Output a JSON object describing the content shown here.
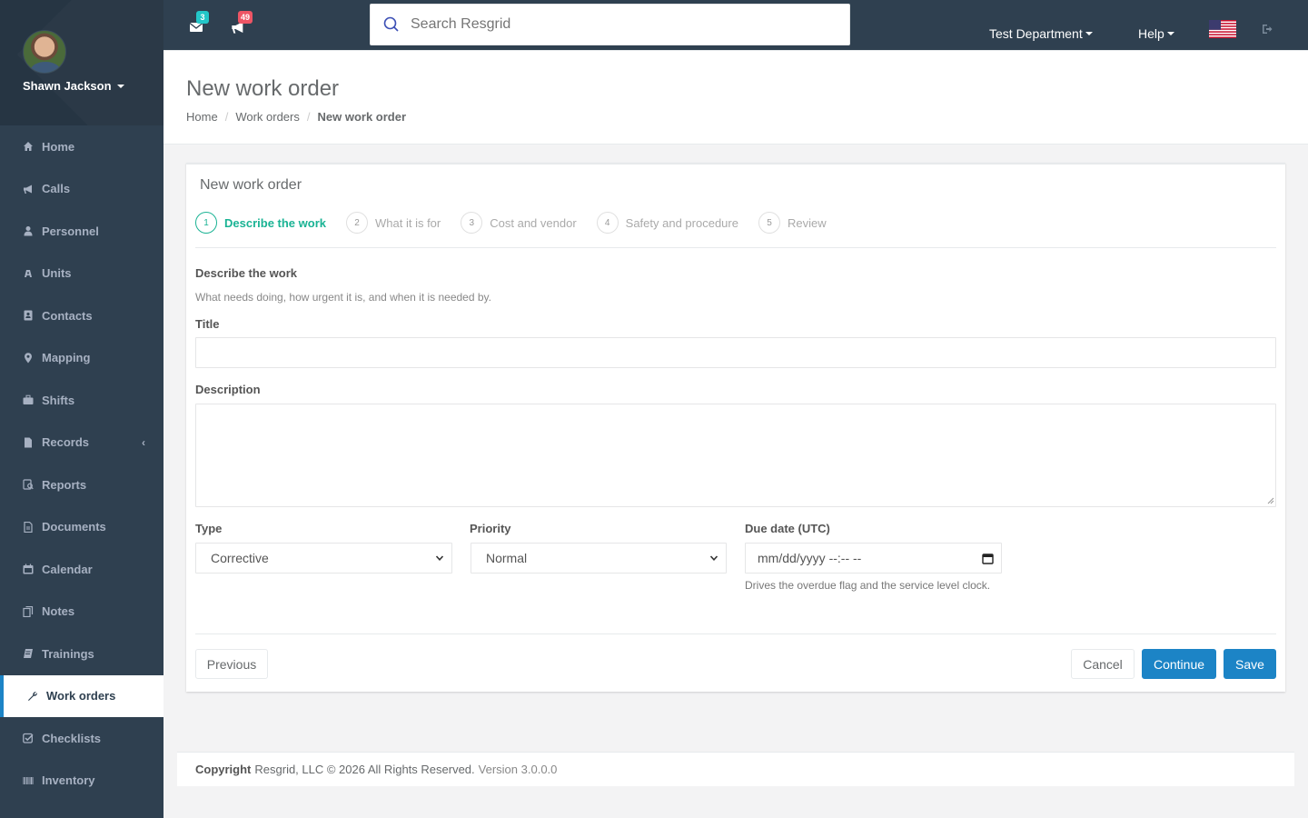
{
  "user": {
    "name": "Shawn Jackson"
  },
  "sidebar": {
    "items": [
      {
        "label": "Home",
        "icon": "home-icon"
      },
      {
        "label": "Calls",
        "icon": "bullhorn-icon"
      },
      {
        "label": "Personnel",
        "icon": "user-icon"
      },
      {
        "label": "Units",
        "icon": "truck-icon"
      },
      {
        "label": "Contacts",
        "icon": "contact-card-icon"
      },
      {
        "label": "Mapping",
        "icon": "map-marker-icon"
      },
      {
        "label": "Shifts",
        "icon": "briefcase-icon"
      },
      {
        "label": "Records",
        "icon": "file-icon",
        "has_submenu": true
      },
      {
        "label": "Reports",
        "icon": "report-icon"
      },
      {
        "label": "Documents",
        "icon": "document-icon"
      },
      {
        "label": "Calendar",
        "icon": "calendar-icon"
      },
      {
        "label": "Notes",
        "icon": "notes-icon"
      },
      {
        "label": "Trainings",
        "icon": "book-icon"
      },
      {
        "label": "Work orders",
        "icon": "wrench-icon",
        "active": true
      },
      {
        "label": "Checklists",
        "icon": "checklist-icon"
      },
      {
        "label": "Inventory",
        "icon": "barcode-icon"
      }
    ],
    "colors": {
      "bg": "#2f4050",
      "active_border": "#1c84c6"
    }
  },
  "topbar": {
    "messages_count": "3",
    "calls_count": "49",
    "search_placeholder": "Search Resgrid",
    "department": "Test Department",
    "help": "Help",
    "language_flag": "us-flag-icon"
  },
  "page": {
    "title": "New work order",
    "breadcrumb": [
      "Home",
      "Work orders",
      "New work order"
    ]
  },
  "form": {
    "card_title": "New work order",
    "steps": [
      {
        "num": "1",
        "label": "Describe the work",
        "active": true
      },
      {
        "num": "2",
        "label": "What it is for"
      },
      {
        "num": "3",
        "label": "Cost and vendor"
      },
      {
        "num": "4",
        "label": "Safety and procedure"
      },
      {
        "num": "5",
        "label": "Review"
      }
    ],
    "section_title": "Describe the work",
    "section_desc": "What needs doing, how urgent it is, and when it is needed by.",
    "title_label": "Title",
    "title_value": "",
    "description_label": "Description",
    "description_value": "",
    "type_label": "Type",
    "type_value": "Corrective",
    "priority_label": "Priority",
    "priority_value": "Normal",
    "due_label": "Due date (UTC)",
    "due_value": "mm/dd/yyyy --:-- --",
    "due_help": "Drives the overdue flag and the service level clock.",
    "buttons": {
      "previous": "Previous",
      "cancel": "Cancel",
      "continue": "Continue",
      "save": "Save"
    },
    "colors": {
      "active_step": "#1ab394",
      "primary": "#1c84c6"
    }
  },
  "footer": {
    "copyright_label": "Copyright",
    "text": "Resgrid, LLC © 2026 All Rights Reserved.",
    "version": "Version 3.0.0.0"
  }
}
